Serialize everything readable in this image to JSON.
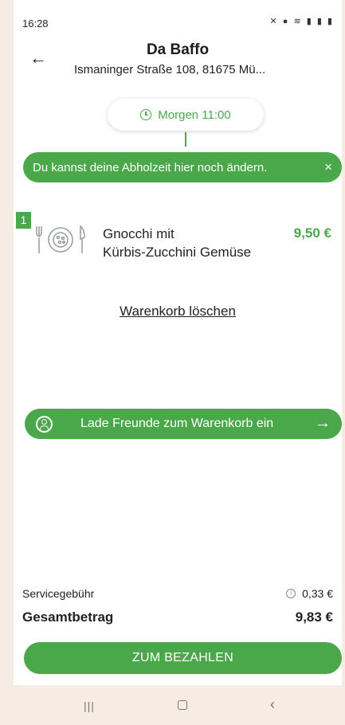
{
  "status": {
    "time": "16:28",
    "icons": "✕ ● ≋ ▮ ▮ ▮"
  },
  "header": {
    "title": "Da Baffo",
    "address": "Ismaninger Straße 108, 81675 Mü..."
  },
  "pickup": {
    "time_label": "Morgen 11:00"
  },
  "tooltip": {
    "text": "Du kannst deine Abholzeit hier noch ändern.",
    "close": "×"
  },
  "cart": {
    "items": [
      {
        "qty": "1",
        "name_line1": "Gnocchi mit",
        "name_line2": "Kürbis-Zucchini Gemüse",
        "price": "9,50 €"
      }
    ],
    "clear_label": "Warenkorb löschen"
  },
  "invite": {
    "label": "Lade Freunde zum Warenkorb ein"
  },
  "summary": {
    "service_fee_label": "Servicegebühr",
    "service_fee_value": "0,33 €",
    "total_label": "Gesamtbetrag",
    "total_value": "9,83 €"
  },
  "pay": {
    "label": "ZUM BEZAHLEN"
  },
  "colors": {
    "accent": "#4aa84a",
    "background": "#f7ece3"
  }
}
